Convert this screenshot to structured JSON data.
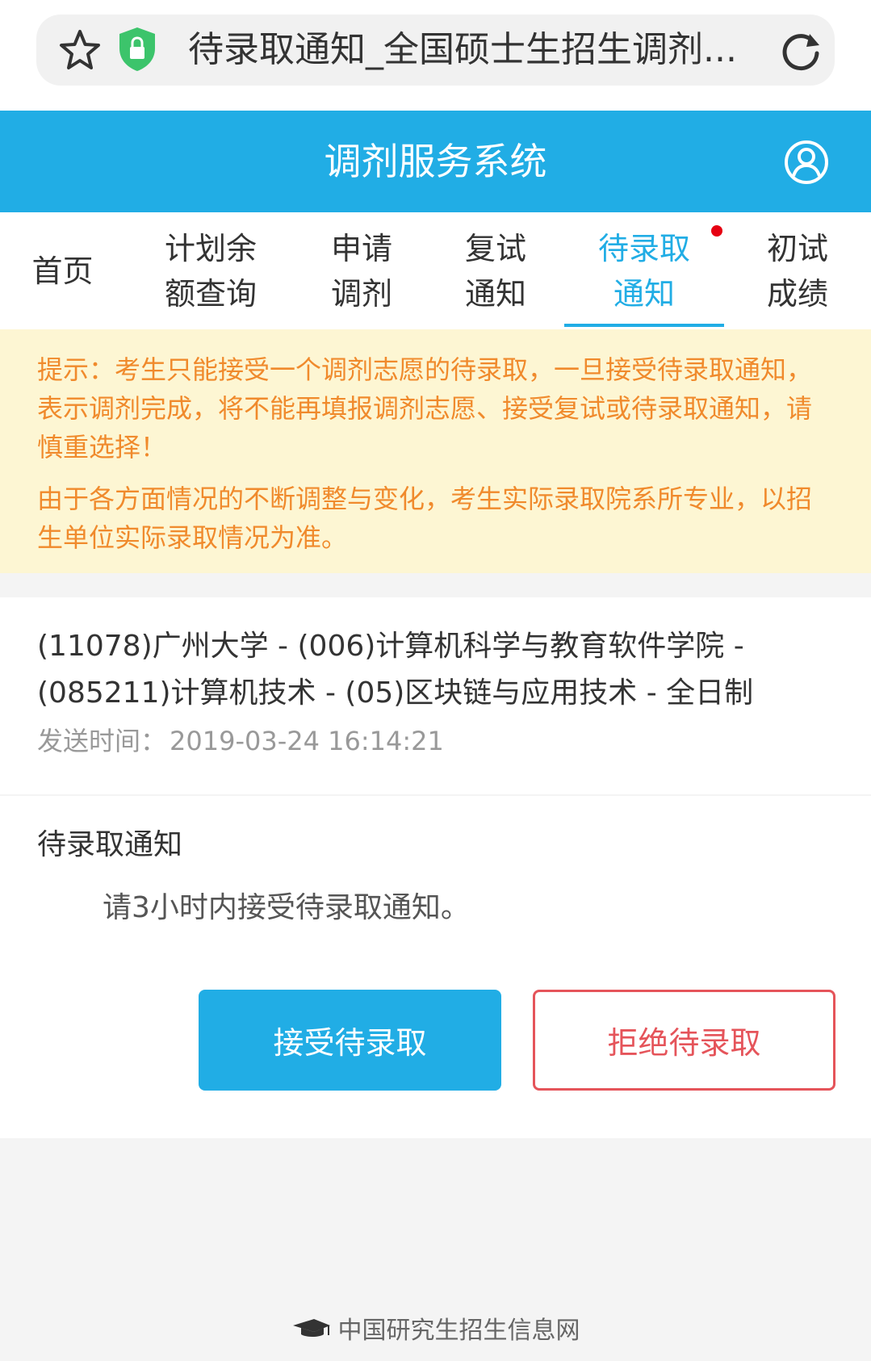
{
  "browser": {
    "page_title": "待录取通知_全国硕士生招生调剂..."
  },
  "header": {
    "title": "调剂服务系统"
  },
  "tabs": [
    {
      "line1": "首页",
      "line2": ""
    },
    {
      "line1": "计划余",
      "line2": "额查询"
    },
    {
      "line1": "申请",
      "line2": "调剂"
    },
    {
      "line1": "复试",
      "line2": "通知"
    },
    {
      "line1": "待录取",
      "line2": "通知"
    },
    {
      "line1": "初试",
      "line2": "成绩"
    }
  ],
  "notice": {
    "p1": "提示：考生只能接受一个调剂志愿的待录取，一旦接受待录取通知，表示调剂完成，将不能再填报调剂志愿、接受复试或待录取通知，请慎重选择！",
    "p2": "由于各方面情况的不断调整与变化，考生实际录取院系所专业，以招生单位实际录取情况为准。"
  },
  "program": {
    "name": "(11078)广州大学 - (006)计算机科学与教育软件学院 - (085211)计算机技术 - (05)区块链与应用技术 - 全日制",
    "send_time_label": "发送时间：",
    "send_time": "2019-03-24 16:14:21"
  },
  "detail": {
    "title": "待录取通知",
    "body": "请3小时内接受待录取通知。"
  },
  "buttons": {
    "accept": "接受待录取",
    "reject": "拒绝待录取"
  },
  "footer": {
    "text": "中国研究生招生信息网"
  },
  "colors": {
    "brand": "#21ade5",
    "notice_bg": "#fdf6d3",
    "notice_text": "#f08a2c",
    "reject": "#e5545a",
    "badge": "#e60012"
  }
}
